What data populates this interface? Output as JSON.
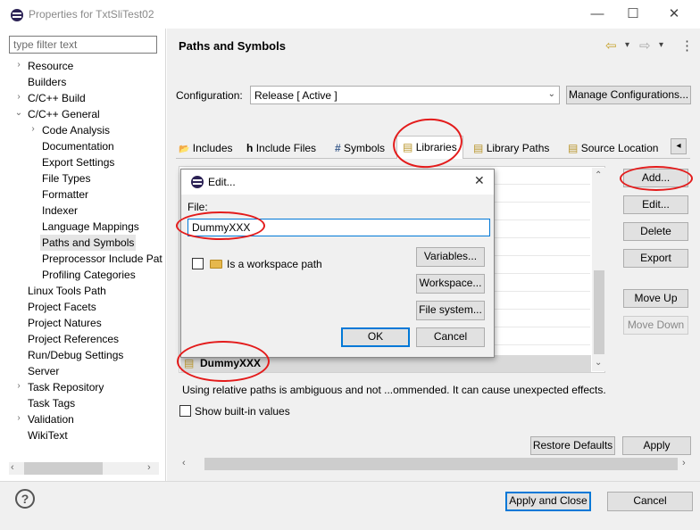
{
  "window": {
    "title": "Properties for TxtSliTest02",
    "min": "—",
    "max": "☐",
    "close": "✕"
  },
  "sidebar": {
    "filter_placeholder": "type filter text",
    "items": [
      {
        "label": "Resource",
        "twisty": "›"
      },
      {
        "label": "Builders",
        "twisty": ""
      },
      {
        "label": "C/C++ Build",
        "twisty": "›"
      },
      {
        "label": "C/C++ General",
        "twisty": "⌄"
      },
      {
        "label": "Code Analysis",
        "twisty": "›"
      },
      {
        "label": "Documentation",
        "twisty": ""
      },
      {
        "label": "Export Settings",
        "twisty": ""
      },
      {
        "label": "File Types",
        "twisty": ""
      },
      {
        "label": "Formatter",
        "twisty": ""
      },
      {
        "label": "Indexer",
        "twisty": ""
      },
      {
        "label": "Language Mappings",
        "twisty": ""
      },
      {
        "label": "Paths and Symbols",
        "twisty": ""
      },
      {
        "label": "Preprocessor Include Pat",
        "twisty": ""
      },
      {
        "label": "Profiling Categories",
        "twisty": ""
      },
      {
        "label": "Linux Tools Path",
        "twisty": ""
      },
      {
        "label": "Project Facets",
        "twisty": ""
      },
      {
        "label": "Project Natures",
        "twisty": ""
      },
      {
        "label": "Project References",
        "twisty": ""
      },
      {
        "label": "Run/Debug Settings",
        "twisty": ""
      },
      {
        "label": "Server",
        "twisty": ""
      },
      {
        "label": "Task Repository",
        "twisty": "›"
      },
      {
        "label": "Task Tags",
        "twisty": ""
      },
      {
        "label": "Validation",
        "twisty": "›"
      },
      {
        "label": "WikiText",
        "twisty": ""
      }
    ],
    "scroll_left": "‹",
    "scroll_right": "›"
  },
  "page": {
    "title": "Paths and Symbols",
    "nav_back": "⇦",
    "nav_forward": "⇨",
    "nav_more": "▾",
    "menu": "⋮",
    "configuration_label": "Configuration:",
    "configuration_value": "Release  [ Active ]",
    "manage_button": "Manage Configurations...",
    "tabs": [
      "Includes",
      "Include Files",
      "Symbols",
      "Libraries",
      "Library Paths",
      "Source Location"
    ],
    "tab_icons": [
      "📂",
      "h",
      "#",
      "▤",
      "▤",
      "▤"
    ],
    "tabs_scroll": "◂",
    "buttons": {
      "add": "Add...",
      "edit": "Edit...",
      "delete": "Delete",
      "export": "Export",
      "move_up": "Move Up",
      "move_down": "Move Down"
    },
    "list_entry": "DummyXXX",
    "warning": "Using relative paths is ambiguous and not ...ommended. It can cause unexpected effects.",
    "show_builtin": "Show built-in values",
    "restore_defaults": "Restore Defaults",
    "apply": "Apply"
  },
  "dialog": {
    "title": "Edit...",
    "close": "✕",
    "file_label": "File:",
    "file_value": "DummyXXX",
    "workspace_path_label": "Is a workspace path",
    "variables": "Variables...",
    "workspace": "Workspace...",
    "file_system": "File system...",
    "ok": "OK",
    "cancel": "Cancel"
  },
  "footer": {
    "help": "?",
    "apply_close": "Apply and Close",
    "cancel": "Cancel"
  },
  "colors": {
    "annotation": "#e31b1b",
    "accent": "#0078d7"
  }
}
